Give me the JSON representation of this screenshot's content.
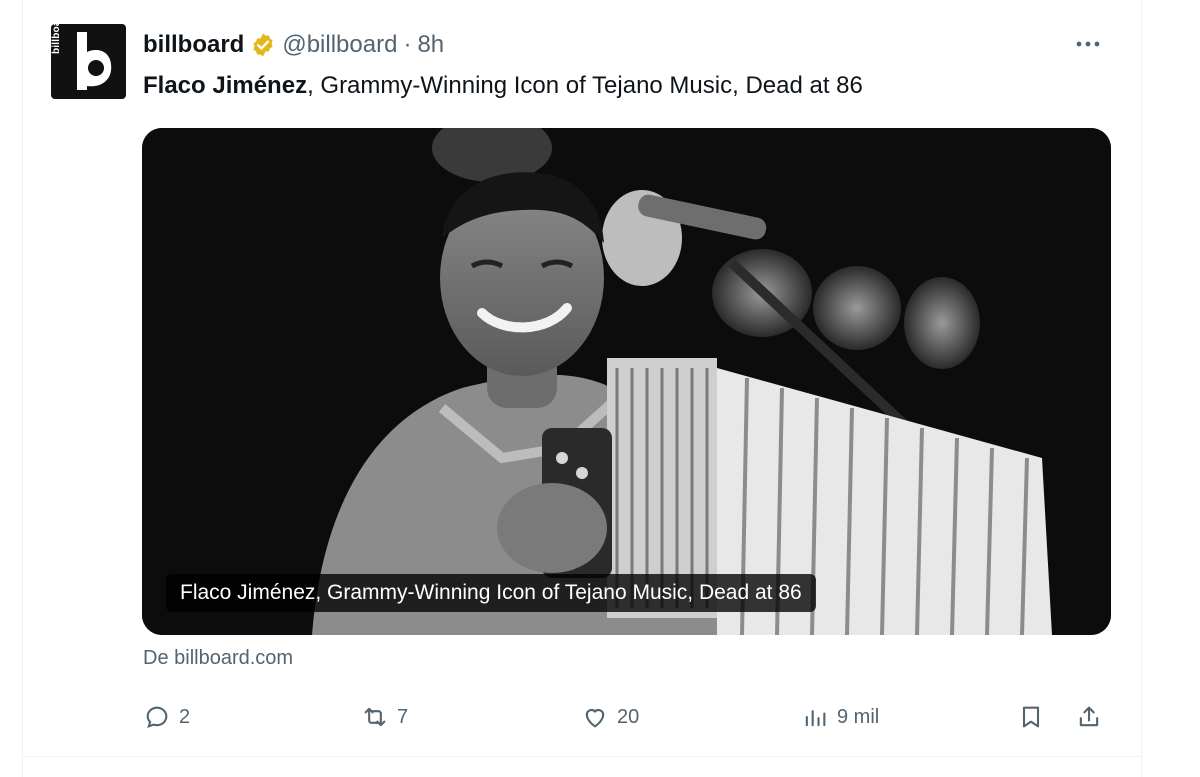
{
  "tweet": {
    "account": {
      "name": "billboard",
      "handle": "@billboard",
      "separator": "·",
      "time": "8h",
      "avatar_text": "billboard",
      "verified_color": "#e2b719"
    },
    "headline_bold": "Flaco Jiménez",
    "headline_rest": ", Grammy-Winning Icon of Tejano Music, Dead at 86",
    "media": {
      "caption": "Flaco Jiménez, Grammy-Winning Icon of Tejano Music, Dead at 86"
    },
    "source": "De billboard.com",
    "actions": {
      "replies": "2",
      "reposts": "7",
      "likes": "20",
      "views": "9 mil"
    }
  }
}
